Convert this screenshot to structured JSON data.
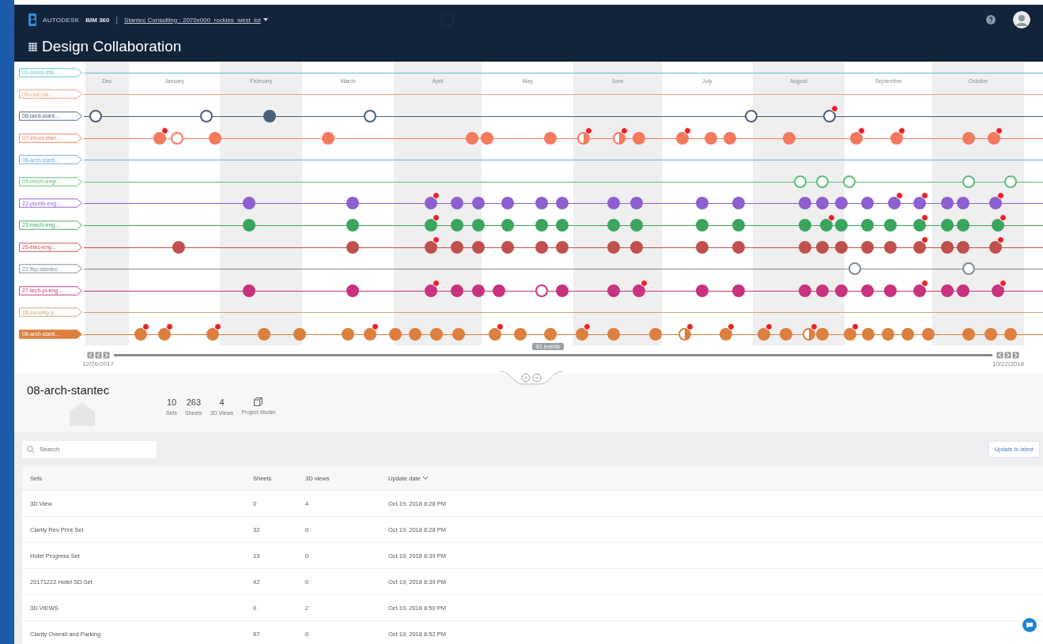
{
  "header": {
    "brand": "AUTODESK",
    "product": "BIM 360",
    "separator": "|",
    "breadcrumb": "Stantec Consulting : 2070x000_rockies_west_lot",
    "module": "Design Collaboration"
  },
  "timeline": {
    "months": [
      {
        "label": "Dec",
        "shaded": true
      },
      {
        "label": "January",
        "shaded": false
      },
      {
        "label": "February",
        "shaded": true
      },
      {
        "label": "March",
        "shaded": false
      },
      {
        "label": "April",
        "shaded": true
      },
      {
        "label": "May",
        "shaded": false
      },
      {
        "label": "June",
        "shaded": true
      },
      {
        "label": "July",
        "shaded": false
      },
      {
        "label": "August",
        "shaded": true
      },
      {
        "label": "September",
        "shaded": false
      },
      {
        "label": "October",
        "shaded": true
      }
    ],
    "lanes": [
      {
        "label": "01-coord-sta…",
        "color": "#5bc2c9",
        "selected": false
      },
      {
        "label": "09-civil-cla…",
        "color": "#e6a27a",
        "selected": false
      },
      {
        "label": "06-land-stant…",
        "color": "#4a607c",
        "selected": false,
        "dots": [
          {
            "level": 0.011,
            "kind": "hollow",
            "badge": false
          },
          {
            "level": 0.129,
            "kind": "hollow",
            "badge": false
          },
          {
            "level": 0.196,
            "kind": "filled",
            "badge": false
          },
          {
            "level": 0.303,
            "kind": "hollow",
            "badge": false
          },
          {
            "level": 0.709,
            "kind": "hollow",
            "badge": false
          },
          {
            "level": 0.793,
            "kind": "hollow",
            "badge": true
          }
        ]
      },
      {
        "label": "07-struct-stan…",
        "color": "#f47a5e",
        "selected": false,
        "dots": [
          {
            "level": 0.079,
            "kind": "filled",
            "badge": true
          },
          {
            "level": 0.098,
            "kind": "hollow",
            "badge": false
          },
          {
            "level": 0.138,
            "kind": "filled",
            "badge": false
          },
          {
            "level": 0.259,
            "kind": "filled",
            "badge": false
          },
          {
            "level": 0.412,
            "kind": "filled",
            "badge": false
          },
          {
            "level": 0.428,
            "kind": "filled",
            "badge": false
          },
          {
            "level": 0.495,
            "kind": "filled",
            "badge": false
          },
          {
            "level": 0.531,
            "kind": "half",
            "badge": true
          },
          {
            "level": 0.569,
            "kind": "half",
            "badge": true
          },
          {
            "level": 0.59,
            "kind": "filled",
            "badge": false
          },
          {
            "level": 0.636,
            "kind": "filled",
            "badge": true
          },
          {
            "level": 0.666,
            "kind": "filled",
            "badge": false
          },
          {
            "level": 0.687,
            "kind": "filled",
            "badge": false
          },
          {
            "level": 0.75,
            "kind": "filled",
            "badge": false
          },
          {
            "level": 0.821,
            "kind": "filled",
            "badge": true
          },
          {
            "level": 0.864,
            "kind": "filled",
            "badge": true
          },
          {
            "level": 0.941,
            "kind": "filled",
            "badge": false
          },
          {
            "level": 0.968,
            "kind": "filled",
            "badge": true
          }
        ]
      },
      {
        "label": "08-arch-stant…",
        "color": "#6fa8dc",
        "selected": false
      },
      {
        "label": "09-mech-engr…",
        "color": "#5cbf7a",
        "selected": false,
        "dots": [
          {
            "level": 0.762,
            "kind": "hollow",
            "badge": false
          },
          {
            "level": 0.785,
            "kind": "hollow",
            "badge": false
          },
          {
            "level": 0.814,
            "kind": "hollow",
            "badge": false
          },
          {
            "level": 0.941,
            "kind": "hollow",
            "badge": false
          },
          {
            "level": 0.986,
            "kind": "hollow",
            "badge": false
          }
        ]
      },
      {
        "label": "22-plumb-eng…",
        "color": "#8e5fce",
        "selected": false,
        "dots": [
          {
            "level": 0.174,
            "kind": "filled",
            "badge": false
          },
          {
            "level": 0.285,
            "kind": "filled",
            "badge": false
          },
          {
            "level": 0.368,
            "kind": "filled",
            "badge": true
          },
          {
            "level": 0.396,
            "kind": "filled",
            "badge": false
          },
          {
            "level": 0.419,
            "kind": "filled",
            "badge": false
          },
          {
            "level": 0.45,
            "kind": "filled",
            "badge": false
          },
          {
            "level": 0.486,
            "kind": "filled",
            "badge": false
          },
          {
            "level": 0.508,
            "kind": "filled",
            "badge": false
          },
          {
            "level": 0.563,
            "kind": "filled",
            "badge": false
          },
          {
            "level": 0.587,
            "kind": "filled",
            "badge": false
          },
          {
            "level": 0.657,
            "kind": "filled",
            "badge": false
          },
          {
            "level": 0.696,
            "kind": "filled",
            "badge": false
          },
          {
            "level": 0.767,
            "kind": "filled",
            "badge": false
          },
          {
            "level": 0.785,
            "kind": "filled",
            "badge": false
          },
          {
            "level": 0.805,
            "kind": "filled",
            "badge": false
          },
          {
            "level": 0.833,
            "kind": "filled",
            "badge": false
          },
          {
            "level": 0.862,
            "kind": "filled",
            "badge": true
          },
          {
            "level": 0.889,
            "kind": "filled",
            "badge": true
          },
          {
            "level": 0.918,
            "kind": "filled",
            "badge": false
          },
          {
            "level": 0.935,
            "kind": "filled",
            "badge": false
          },
          {
            "level": 0.97,
            "kind": "filled",
            "badge": true
          }
        ]
      },
      {
        "label": "23-mech-eng…",
        "color": "#3aa55c",
        "selected": false,
        "dots": [
          {
            "level": 0.174,
            "kind": "filled",
            "badge": false
          },
          {
            "level": 0.285,
            "kind": "filled",
            "badge": false
          },
          {
            "level": 0.368,
            "kind": "filled",
            "badge": true
          },
          {
            "level": 0.396,
            "kind": "filled",
            "badge": false
          },
          {
            "level": 0.419,
            "kind": "filled",
            "badge": false
          },
          {
            "level": 0.45,
            "kind": "filled",
            "badge": false
          },
          {
            "level": 0.486,
            "kind": "filled",
            "badge": false
          },
          {
            "level": 0.508,
            "kind": "filled",
            "badge": false
          },
          {
            "level": 0.563,
            "kind": "filled",
            "badge": false
          },
          {
            "level": 0.587,
            "kind": "filled",
            "badge": false
          },
          {
            "level": 0.657,
            "kind": "filled",
            "badge": false
          },
          {
            "level": 0.696,
            "kind": "filled",
            "badge": false
          },
          {
            "level": 0.767,
            "kind": "filled",
            "badge": false
          },
          {
            "level": 0.789,
            "kind": "filled",
            "badge": true
          },
          {
            "level": 0.805,
            "kind": "filled",
            "badge": false
          },
          {
            "level": 0.833,
            "kind": "filled",
            "badge": false
          },
          {
            "level": 0.858,
            "kind": "filled",
            "badge": false
          },
          {
            "level": 0.889,
            "kind": "filled",
            "badge": true
          },
          {
            "level": 0.918,
            "kind": "filled",
            "badge": false
          },
          {
            "level": 0.935,
            "kind": "filled",
            "badge": false
          },
          {
            "level": 0.972,
            "kind": "filled",
            "badge": true
          }
        ]
      },
      {
        "label": "26-elec-eng…",
        "color": "#c0504d",
        "selected": false,
        "dots": [
          {
            "level": 0.099,
            "kind": "filled",
            "badge": false
          },
          {
            "level": 0.285,
            "kind": "filled",
            "badge": false
          },
          {
            "level": 0.368,
            "kind": "filled",
            "badge": true
          },
          {
            "level": 0.396,
            "kind": "filled",
            "badge": false
          },
          {
            "level": 0.419,
            "kind": "filled",
            "badge": false
          },
          {
            "level": 0.45,
            "kind": "filled",
            "badge": false
          },
          {
            "level": 0.486,
            "kind": "filled",
            "badge": false
          },
          {
            "level": 0.508,
            "kind": "filled",
            "badge": false
          },
          {
            "level": 0.563,
            "kind": "filled",
            "badge": false
          },
          {
            "level": 0.587,
            "kind": "filled",
            "badge": false
          },
          {
            "level": 0.657,
            "kind": "filled",
            "badge": false
          },
          {
            "level": 0.696,
            "kind": "filled",
            "badge": false
          },
          {
            "level": 0.767,
            "kind": "filled",
            "badge": false
          },
          {
            "level": 0.785,
            "kind": "filled",
            "badge": false
          },
          {
            "level": 0.805,
            "kind": "filled",
            "badge": false
          },
          {
            "level": 0.833,
            "kind": "filled",
            "badge": false
          },
          {
            "level": 0.858,
            "kind": "filled",
            "badge": false
          },
          {
            "level": 0.889,
            "kind": "filled",
            "badge": true
          },
          {
            "level": 0.918,
            "kind": "filled",
            "badge": false
          },
          {
            "level": 0.935,
            "kind": "filled",
            "badge": false
          },
          {
            "level": 0.97,
            "kind": "filled",
            "badge": true
          }
        ]
      },
      {
        "label": "22-fbp-stantec",
        "color": "#7f8b95",
        "selected": false,
        "dots": [
          {
            "level": 0.82,
            "kind": "hollow",
            "badge": false
          },
          {
            "level": 0.941,
            "kind": "hollow",
            "badge": false
          }
        ]
      },
      {
        "label": "27-tech-pl-eng…",
        "color": "#c8327e",
        "selected": false,
        "dots": [
          {
            "level": 0.174,
            "kind": "filled",
            "badge": false
          },
          {
            "level": 0.285,
            "kind": "filled",
            "badge": false
          },
          {
            "level": 0.368,
            "kind": "filled",
            "badge": true
          },
          {
            "level": 0.396,
            "kind": "filled",
            "badge": false
          },
          {
            "level": 0.419,
            "kind": "filled",
            "badge": false
          },
          {
            "level": 0.441,
            "kind": "filled",
            "badge": false
          },
          {
            "level": 0.486,
            "kind": "hollow",
            "badge": false
          },
          {
            "level": 0.508,
            "kind": "filled",
            "badge": false
          },
          {
            "level": 0.563,
            "kind": "filled",
            "badge": false
          },
          {
            "level": 0.59,
            "kind": "filled",
            "badge": true
          },
          {
            "level": 0.657,
            "kind": "filled",
            "badge": false
          },
          {
            "level": 0.696,
            "kind": "filled",
            "badge": false
          },
          {
            "level": 0.767,
            "kind": "filled",
            "badge": false
          },
          {
            "level": 0.785,
            "kind": "filled",
            "badge": false
          },
          {
            "level": 0.805,
            "kind": "filled",
            "badge": false
          },
          {
            "level": 0.833,
            "kind": "filled",
            "badge": false
          },
          {
            "level": 0.858,
            "kind": "filled",
            "badge": false
          },
          {
            "level": 0.889,
            "kind": "filled",
            "badge": true
          },
          {
            "level": 0.918,
            "kind": "filled",
            "badge": false
          },
          {
            "level": 0.935,
            "kind": "filled",
            "badge": false
          },
          {
            "level": 0.972,
            "kind": "filled",
            "badge": true
          }
        ]
      },
      {
        "label": "28-security-p…",
        "color": "#c9a77c",
        "selected": false
      },
      {
        "label": "08-arch-stant…",
        "color": "#dc8040",
        "selected": true,
        "dots": [
          {
            "level": 0.059,
            "kind": "filled",
            "badge": true
          },
          {
            "level": 0.084,
            "kind": "filled",
            "badge": true
          },
          {
            "level": 0.136,
            "kind": "filled",
            "badge": true
          },
          {
            "level": 0.19,
            "kind": "filled",
            "badge": false
          },
          {
            "level": 0.228,
            "kind": "filled",
            "badge": false
          },
          {
            "level": 0.28,
            "kind": "filled",
            "badge": false
          },
          {
            "level": 0.303,
            "kind": "filled",
            "badge": true
          },
          {
            "level": 0.33,
            "kind": "filled",
            "badge": false
          },
          {
            "level": 0.351,
            "kind": "filled",
            "badge": false
          },
          {
            "level": 0.374,
            "kind": "filled",
            "badge": false
          },
          {
            "level": 0.398,
            "kind": "filled",
            "badge": false
          },
          {
            "level": 0.436,
            "kind": "filled",
            "badge": true
          },
          {
            "level": 0.463,
            "kind": "filled",
            "badge": false
          },
          {
            "level": 0.495,
            "kind": "filled",
            "badge": false
          },
          {
            "level": 0.529,
            "kind": "filled",
            "badge": true
          },
          {
            "level": 0.563,
            "kind": "filled",
            "badge": false
          },
          {
            "level": 0.607,
            "kind": "filled",
            "badge": false
          },
          {
            "level": 0.639,
            "kind": "half",
            "badge": true
          },
          {
            "level": 0.682,
            "kind": "filled",
            "badge": true
          },
          {
            "level": 0.723,
            "kind": "filled",
            "badge": true
          },
          {
            "level": 0.746,
            "kind": "filled",
            "badge": false
          },
          {
            "level": 0.771,
            "kind": "half",
            "badge": true
          },
          {
            "level": 0.785,
            "kind": "filled",
            "badge": false
          },
          {
            "level": 0.815,
            "kind": "filled",
            "badge": true
          },
          {
            "level": 0.834,
            "kind": "filled",
            "badge": false
          },
          {
            "level": 0.855,
            "kind": "filled",
            "badge": false
          },
          {
            "level": 0.876,
            "kind": "filled",
            "badge": false
          },
          {
            "level": 0.898,
            "kind": "filled",
            "badge": false
          },
          {
            "level": 0.941,
            "kind": "filled",
            "badge": false
          },
          {
            "level": 0.965,
            "kind": "filled",
            "badge": false
          },
          {
            "level": 0.986,
            "kind": "filled",
            "badge": false
          }
        ]
      }
    ]
  },
  "scrubber": {
    "label": "61 events",
    "start_date": "12/26/2017",
    "end_date": "10/22/2018"
  },
  "details": {
    "title": "08-arch-stantec",
    "stats": [
      {
        "value": "10",
        "label": "Sets"
      },
      {
        "value": "263",
        "label": "Sheets"
      },
      {
        "value": "4",
        "label": "3D Views"
      }
    ],
    "model_label": "Project Model"
  },
  "toolbar": {
    "search_placeholder": "Search",
    "update_button": "Update to latest"
  },
  "table": {
    "columns": [
      {
        "label": "Sets",
        "sorted": false
      },
      {
        "label": "Sheets",
        "sorted": false
      },
      {
        "label": "3D views",
        "sorted": false
      },
      {
        "label": "Update date",
        "sorted": true
      }
    ],
    "rows": [
      [
        "3D View",
        "0",
        "4",
        "Oct 19, 2018 8:28 PM"
      ],
      [
        "Clarity Rev Print Set",
        "32",
        "0",
        "Oct 19, 2018 8:28 PM"
      ],
      [
        "Hotel Progress Set",
        "13",
        "0",
        "Oct 19, 2018 8:39 PM"
      ],
      [
        "20171222 Hotel SD Set",
        "42",
        "0",
        "Oct 19, 2018 8:39 PM"
      ],
      [
        "3D VIEWS",
        "0",
        "2",
        "Oct 19, 2018 8:50 PM"
      ],
      [
        "Clarity Overall and Parking",
        "87",
        "0",
        "Oct 19, 2018 8:52 PM"
      ]
    ]
  }
}
